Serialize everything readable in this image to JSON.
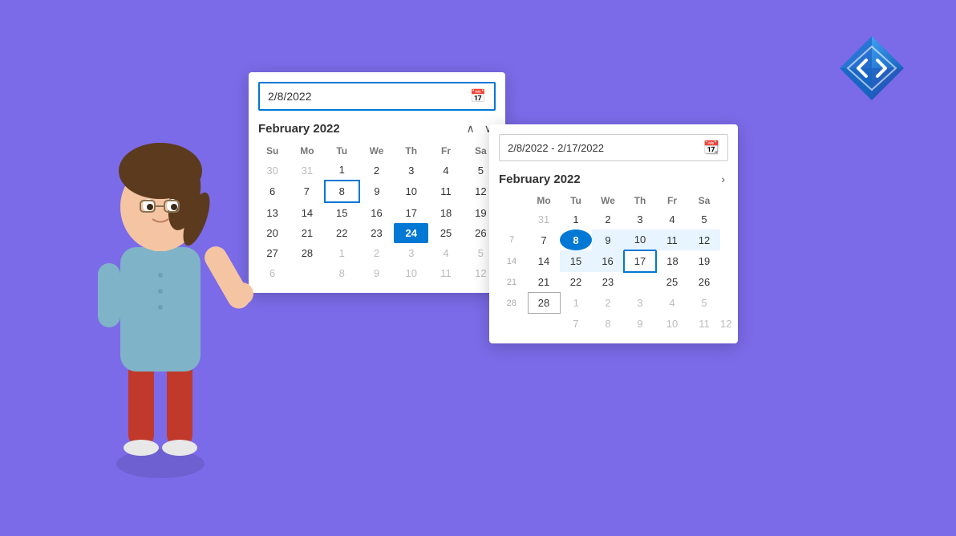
{
  "background": "#7B6BE8",
  "single_picker": {
    "input_value": "2/8/2022",
    "month_label": "February 2022",
    "weekdays": [
      "Su",
      "Mo",
      "Tu",
      "We",
      "Th",
      "Fr",
      "Sa"
    ],
    "rows": [
      [
        {
          "d": "30",
          "cls": "other-month"
        },
        {
          "d": "31",
          "cls": "other-month"
        },
        {
          "d": "1",
          "cls": ""
        },
        {
          "d": "2",
          "cls": ""
        },
        {
          "d": "3",
          "cls": ""
        },
        {
          "d": "4",
          "cls": ""
        },
        {
          "d": "5",
          "cls": ""
        }
      ],
      [
        {
          "d": "6",
          "cls": ""
        },
        {
          "d": "7",
          "cls": ""
        },
        {
          "d": "8",
          "cls": "outlined"
        },
        {
          "d": "9",
          "cls": ""
        },
        {
          "d": "10",
          "cls": ""
        },
        {
          "d": "11",
          "cls": ""
        },
        {
          "d": "12",
          "cls": ""
        }
      ],
      [
        {
          "d": "13",
          "cls": ""
        },
        {
          "d": "14",
          "cls": ""
        },
        {
          "d": "15",
          "cls": ""
        },
        {
          "d": "16",
          "cls": ""
        },
        {
          "d": "17",
          "cls": ""
        },
        {
          "d": "18",
          "cls": ""
        },
        {
          "d": "19",
          "cls": ""
        }
      ],
      [
        {
          "d": "20",
          "cls": ""
        },
        {
          "d": "21",
          "cls": ""
        },
        {
          "d": "22",
          "cls": ""
        },
        {
          "d": "23",
          "cls": ""
        },
        {
          "d": "24",
          "cls": "selected-single"
        },
        {
          "d": "25",
          "cls": ""
        },
        {
          "d": "26",
          "cls": ""
        }
      ],
      [
        {
          "d": "27",
          "cls": ""
        },
        {
          "d": "28",
          "cls": ""
        },
        {
          "d": "1",
          "cls": "other-month"
        },
        {
          "d": "2",
          "cls": "other-month"
        },
        {
          "d": "3",
          "cls": "other-month"
        },
        {
          "d": "4",
          "cls": "other-month"
        },
        {
          "d": "5",
          "cls": "other-month"
        }
      ],
      [
        {
          "d": "6",
          "cls": "other-month"
        },
        {
          "d": "",
          "cls": "other-month"
        },
        {
          "d": "8",
          "cls": "other-month"
        },
        {
          "d": "9",
          "cls": "other-month"
        },
        {
          "d": "10",
          "cls": "other-month"
        },
        {
          "d": "11",
          "cls": "other-month"
        },
        {
          "d": "12",
          "cls": "other-month"
        }
      ]
    ]
  },
  "range_picker": {
    "input_value": "2/8/2022 - 2/17/2022",
    "month_label": "February 2022",
    "weekdays": [
      "Mo",
      "Tu",
      "We",
      "Th",
      "Fr",
      "Sa"
    ],
    "rows": [
      [
        {
          "d": "31",
          "cls": "other-month"
        },
        {
          "d": "1",
          "cls": ""
        },
        {
          "d": "2",
          "cls": ""
        },
        {
          "d": "3",
          "cls": ""
        },
        {
          "d": "4",
          "cls": ""
        },
        {
          "d": "5",
          "cls": ""
        }
      ],
      [
        {
          "d": "7",
          "cls": ""
        },
        {
          "d": "8",
          "cls": "range-start"
        },
        {
          "d": "9",
          "cls": "in-range"
        },
        {
          "d": "10",
          "cls": "in-range"
        },
        {
          "d": "11",
          "cls": "in-range"
        },
        {
          "d": "12",
          "cls": "in-range"
        }
      ],
      [
        {
          "d": "14",
          "cls": ""
        },
        {
          "d": "15",
          "cls": "in-range"
        },
        {
          "d": "16",
          "cls": "in-range"
        },
        {
          "d": "17",
          "cls": "range-end"
        },
        {
          "d": "18",
          "cls": ""
        },
        {
          "d": "19",
          "cls": ""
        }
      ],
      [
        {
          "d": "21",
          "cls": ""
        },
        {
          "d": "22",
          "cls": ""
        },
        {
          "d": "23",
          "cls": ""
        },
        {
          "d": "",
          "cls": ""
        },
        {
          "d": "25",
          "cls": ""
        },
        {
          "d": "26",
          "cls": ""
        }
      ],
      [
        {
          "d": "28",
          "cls": "boundary-end"
        },
        {
          "d": "1",
          "cls": "other-month"
        },
        {
          "d": "2",
          "cls": "other-month"
        },
        {
          "d": "3",
          "cls": "other-month"
        },
        {
          "d": "4",
          "cls": "other-month"
        },
        {
          "d": "5",
          "cls": "other-month"
        }
      ],
      [
        {
          "d": "",
          "cls": "other-month"
        },
        {
          "d": "7",
          "cls": "other-month"
        },
        {
          "d": "8",
          "cls": "other-month"
        },
        {
          "d": "9",
          "cls": "other-month"
        },
        {
          "d": "10",
          "cls": "other-month"
        },
        {
          "d": "11",
          "cls": "other-month"
        },
        {
          "d": "12",
          "cls": "other-month"
        }
      ]
    ]
  }
}
